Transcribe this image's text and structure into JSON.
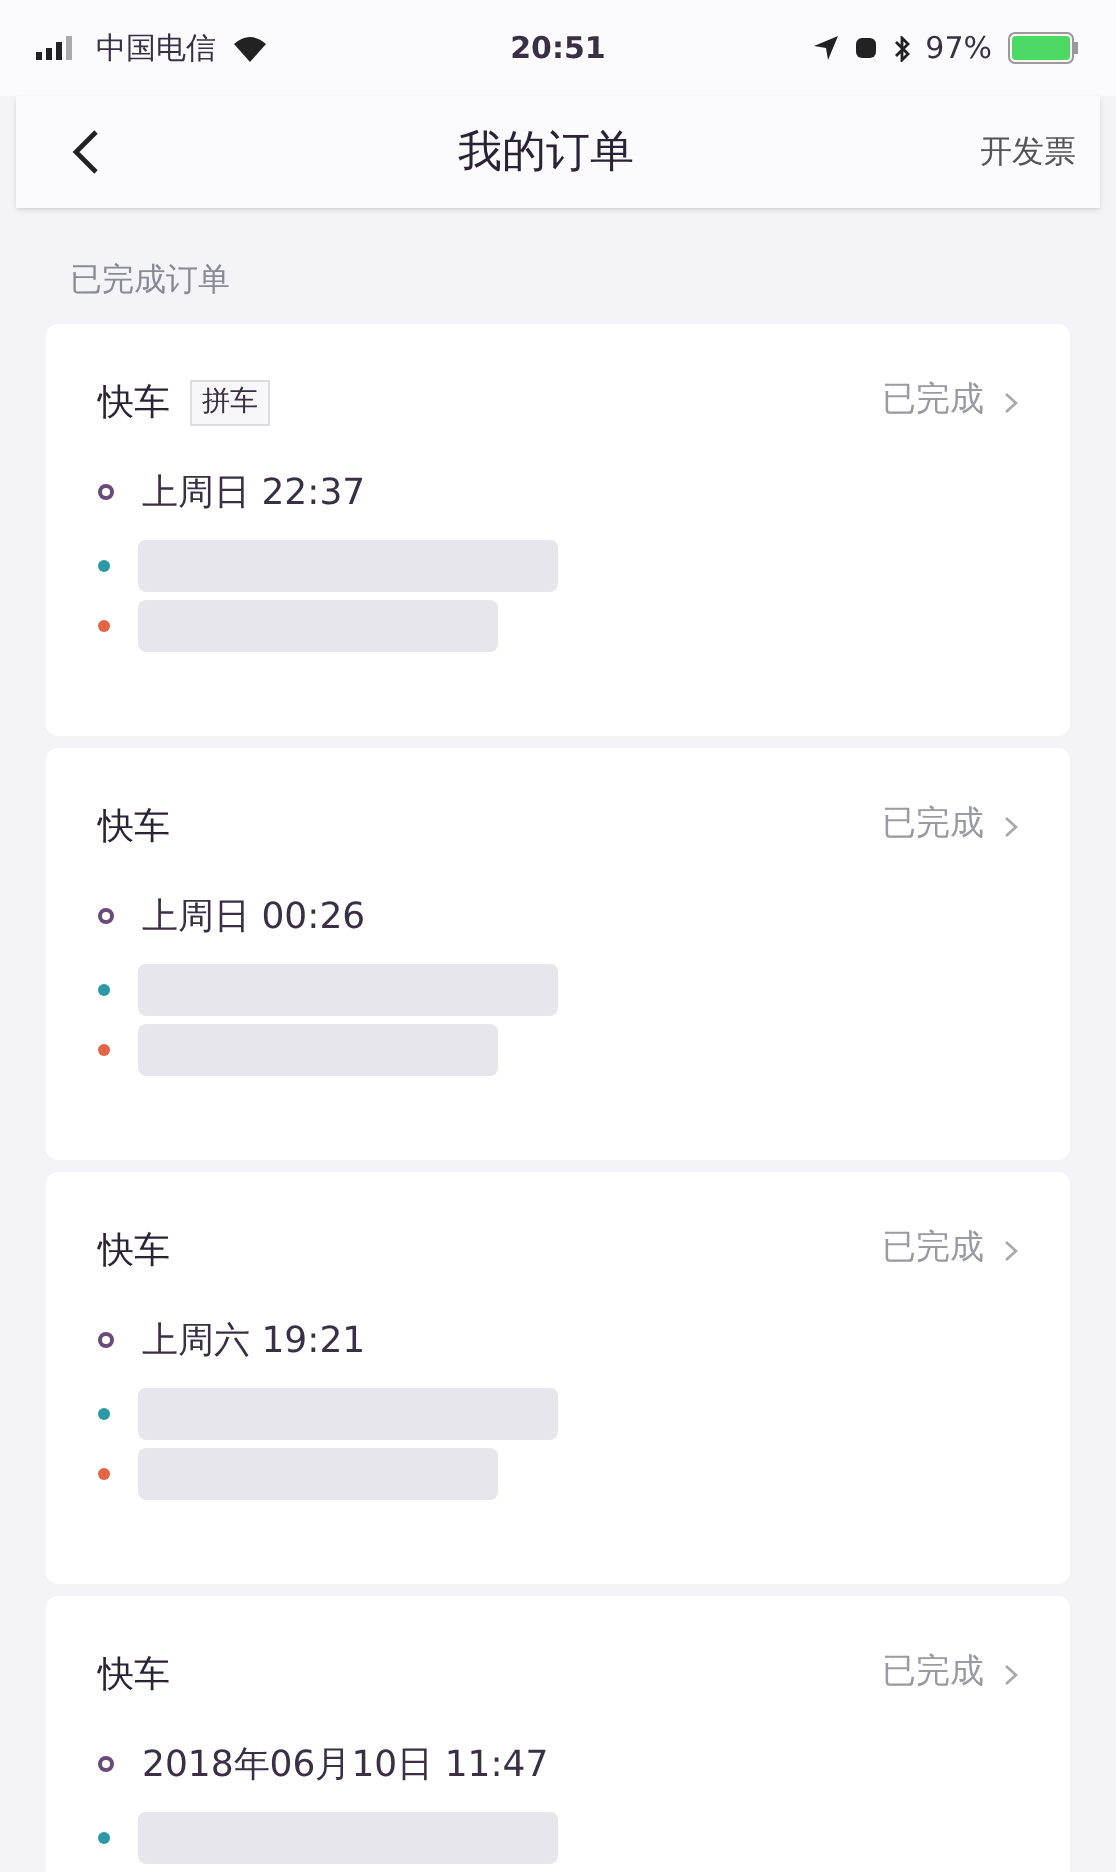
{
  "status_bar": {
    "carrier": "中国电信",
    "time": "20:51",
    "battery": "97%"
  },
  "nav": {
    "title": "我的订单",
    "action": "开发票"
  },
  "section_title": "已完成订单",
  "orders": [
    {
      "type": "快车",
      "tag": "拼车",
      "status": "已完成",
      "time": "上周日 22:37",
      "stops": [
        {
          "kind": "start",
          "color": "#2a9aa6"
        },
        {
          "kind": "end",
          "color": "#e2654a"
        }
      ]
    },
    {
      "type": "快车",
      "status": "已完成",
      "time": "上周日 00:26",
      "stops": [
        {
          "kind": "start",
          "color": "#2a9aa6"
        },
        {
          "kind": "end",
          "color": "#e2654a"
        }
      ]
    },
    {
      "type": "快车",
      "status": "已完成",
      "time": "上周六 19:21",
      "stops": [
        {
          "kind": "start",
          "color": "#2a9aa6"
        },
        {
          "kind": "end",
          "color": "#e2654a"
        }
      ]
    },
    {
      "type": "快车",
      "status": "已完成",
      "time": "2018年06月10日 11:47",
      "stops": [
        {
          "kind": "start",
          "color": "#2a9aa6"
        }
      ]
    }
  ]
}
